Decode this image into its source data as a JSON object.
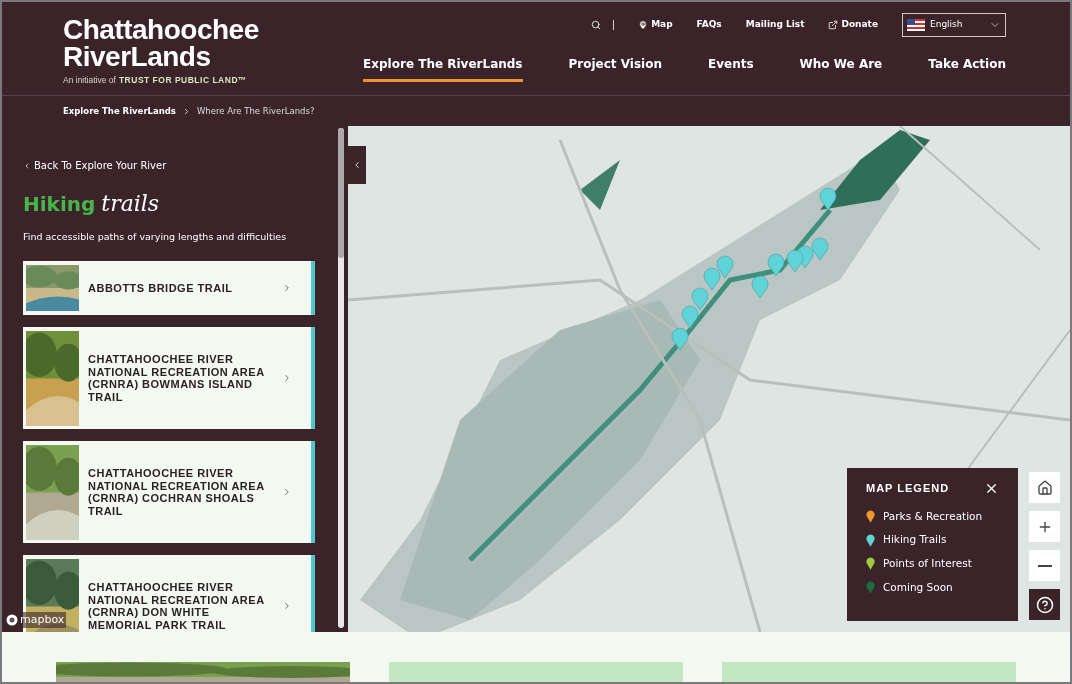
{
  "logo": {
    "line1": "Chattahoochee",
    "line2": "RiverLands",
    "tagline_prefix": "An initiative of",
    "tagline_brand": "TRUST FOR PUBLIC LAND™"
  },
  "utility_nav": [
    {
      "kind": "search"
    },
    {
      "kind": "pin",
      "label": "Map"
    },
    {
      "kind": "plain",
      "label": "FAQs"
    },
    {
      "kind": "plain",
      "label": "Mailing List"
    },
    {
      "kind": "external",
      "label": "Donate"
    }
  ],
  "language": {
    "value": "English"
  },
  "main_nav": [
    {
      "label": "Explore The RiverLands",
      "selected": true
    },
    {
      "label": "Project Vision",
      "selected": false
    },
    {
      "label": "Events",
      "selected": false
    },
    {
      "label": "Who We Are",
      "selected": false
    },
    {
      "label": "Take Action",
      "selected": false
    }
  ],
  "breadcrumb": [
    "Explore The RiverLands",
    "Where Are The RiverLands?"
  ],
  "sidebar": {
    "back_link": "Back To Explore Your River",
    "title_bold": "Hiking",
    "title_script": "trails",
    "subtitle": "Find accessible paths of varying lengths and difficulties",
    "trails": [
      {
        "name": "ABBOTTS BRIDGE TRAIL"
      },
      {
        "name": "CHATTAHOOCHEE RIVER NATIONAL RECREATION AREA (CRNRA) BOWMANS ISLAND TRAIL"
      },
      {
        "name": "CHATTAHOOCHEE RIVER NATIONAL RECREATION AREA (CRNRA) COCHRAN SHOALS TRAIL"
      },
      {
        "name": "CHATTAHOOCHEE RIVER NATIONAL RECREATION AREA (CRNRA) DON WHITE MEMORIAL PARK TRAIL"
      }
    ]
  },
  "map_attribution": "mapbox",
  "legend": {
    "title": "MAP LEGEND",
    "items": [
      {
        "label": "Parks & Recreation",
        "color": "#f0962a"
      },
      {
        "label": "Hiking Trails",
        "color": "#5fd3d8"
      },
      {
        "label": "Points of Interest",
        "color": "#9ccc3c"
      },
      {
        "label": "Coming Soon",
        "color": "#1d6b3e"
      }
    ]
  },
  "bottom_cards": [
    {
      "kind": "picture"
    },
    {
      "kind": "placeholder"
    },
    {
      "kind": "placeholder"
    }
  ]
}
